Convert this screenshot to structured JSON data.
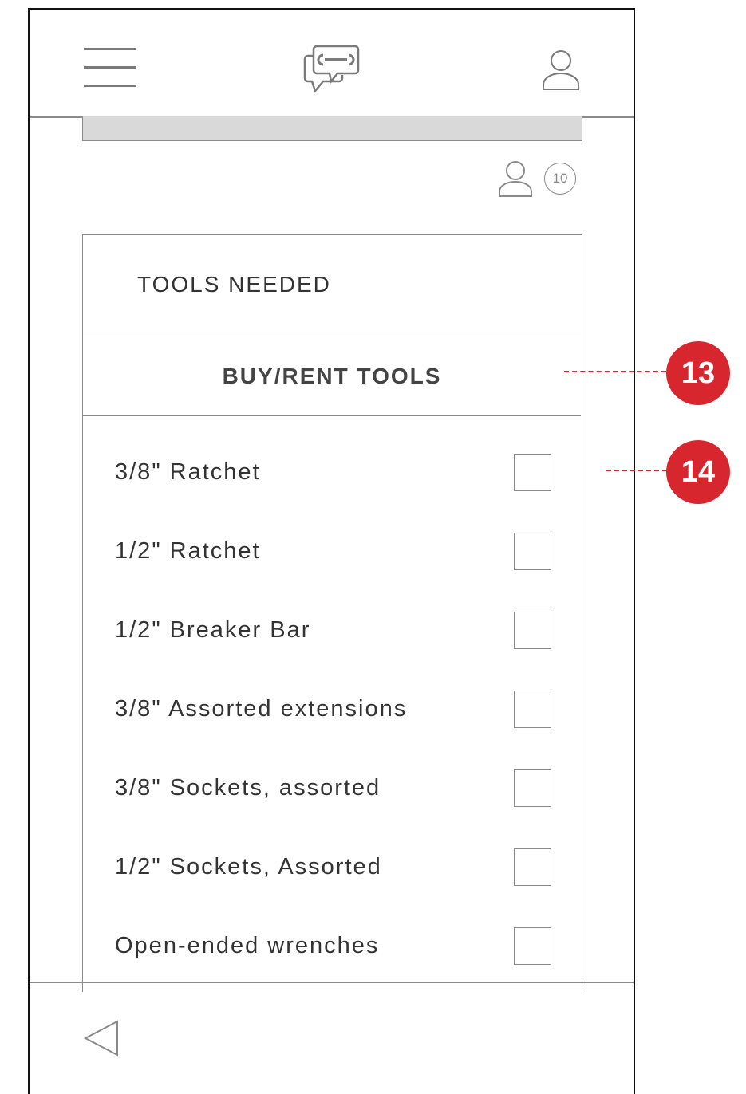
{
  "header": {
    "menu_icon": "hamburger-menu-icon",
    "logo_icon": "chat-wrench-logo-icon",
    "profile_icon": "user-profile-icon"
  },
  "meta": {
    "user_icon": "user-icon",
    "count": "10"
  },
  "panel": {
    "title": "TOOLS NEEDED",
    "buy_rent_label": "BUY/RENT TOOLS",
    "items": [
      {
        "label": "3/8\" Ratchet",
        "checked": false
      },
      {
        "label": "1/2\" Ratchet",
        "checked": false
      },
      {
        "label": "1/2\" Breaker Bar",
        "checked": false
      },
      {
        "label": "3/8\" Assorted extensions",
        "checked": false
      },
      {
        "label": "3/8\" Sockets, assorted",
        "checked": false
      },
      {
        "label": "1/2\" Sockets, Assorted",
        "checked": false
      },
      {
        "label": "Open-ended wrenches",
        "checked": false
      }
    ]
  },
  "footer": {
    "back_icon": "back-triangle-icon"
  },
  "callouts": [
    {
      "number": "13"
    },
    {
      "number": "14"
    }
  ],
  "colors": {
    "callout": "#d8262f",
    "line": "#8a8a8a",
    "bar": "#d9d9d9"
  }
}
